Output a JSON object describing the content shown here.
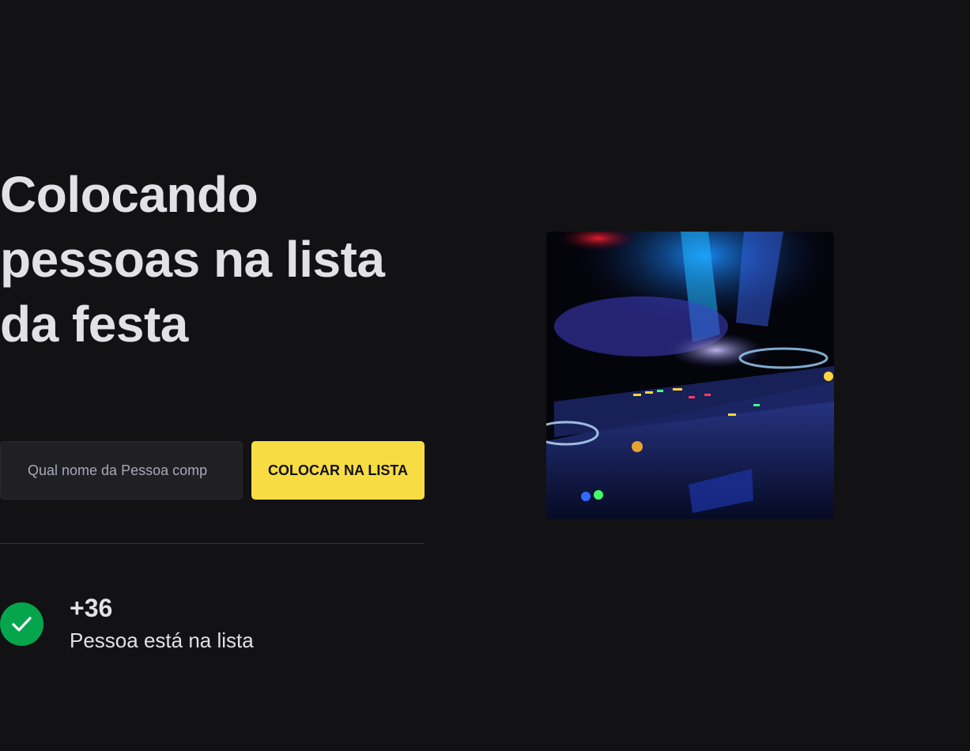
{
  "hero": {
    "title_line1": "Colocando",
    "title_line2": "pessoas na lista",
    "title_line3": "da festa"
  },
  "form": {
    "input_placeholder": "Qual nome da Pessoa comp",
    "button_label": "COLOCAR NA LISTA"
  },
  "counter": {
    "value": "+36",
    "label": "Pessoa está na lista",
    "icon": "check-icon"
  },
  "image": {
    "subject": "dj-mixer-photo"
  },
  "colors": {
    "background": "#121214",
    "accent_yellow": "#f7dd43",
    "success_green": "#04a54d",
    "input_background": "#202024",
    "text": "#e1e1e6"
  }
}
